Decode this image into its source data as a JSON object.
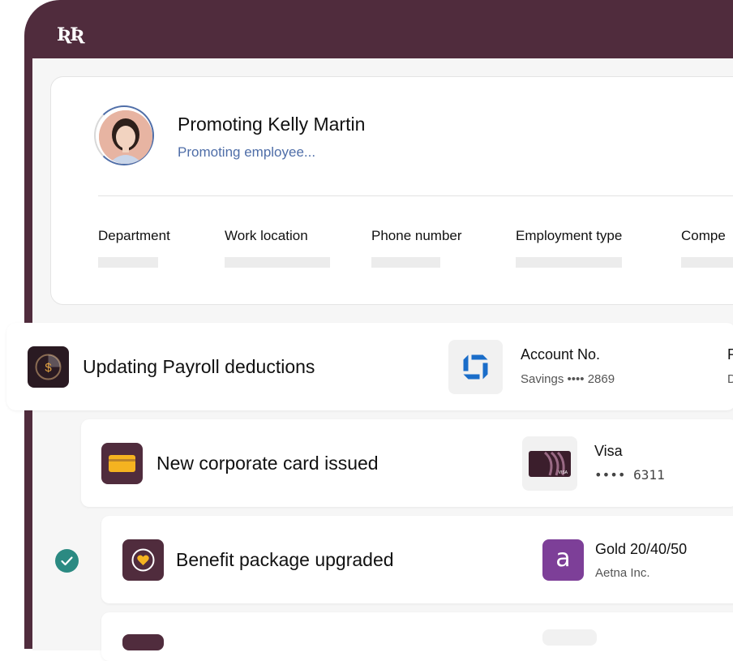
{
  "header": {
    "logo_text": "ƦƦ"
  },
  "profile": {
    "title": "Promoting Kelly Martin",
    "status": "Promoting employee..."
  },
  "fields": [
    {
      "label": "Department"
    },
    {
      "label": "Work location"
    },
    {
      "label": "Phone number"
    },
    {
      "label": "Employment type"
    },
    {
      "label": "Compe"
    }
  ],
  "payroll": {
    "label": "Updating Payroll deductions",
    "account_title": "Account No.",
    "account_sub": "Savings •••• 2869",
    "cut_title": "R",
    "cut_sub": "D"
  },
  "card": {
    "label": "New corporate card issued",
    "brand": "Visa",
    "number": "•••• 6311",
    "card_mark": "VISA"
  },
  "benefit": {
    "label": "Benefit package upgraded",
    "plan": "Gold 20/40/50",
    "provider": "Aetna Inc.",
    "provider_logo_letter": "a"
  },
  "colors": {
    "brand": "#502c3d",
    "accent_blue": "#4f6ea8",
    "check_teal": "#2b8a82",
    "aetna_purple": "#7d3f98",
    "chase_blue": "#1a6dc9",
    "card_yellow": "#f5b320"
  }
}
